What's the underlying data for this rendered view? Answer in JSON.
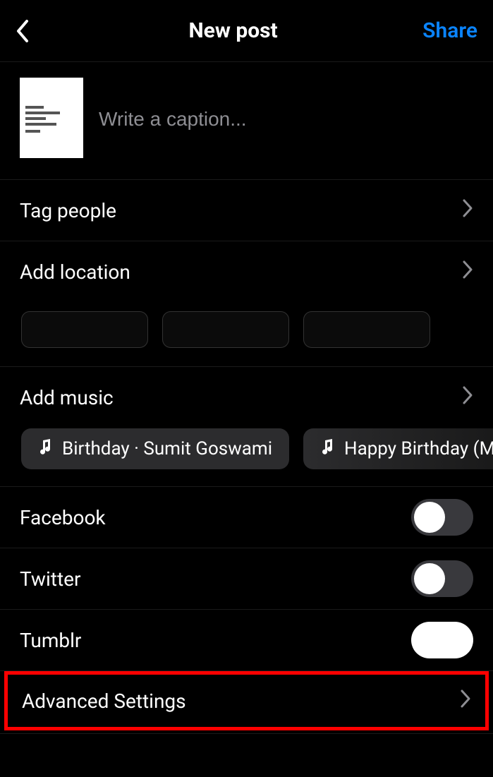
{
  "header": {
    "title": "New post",
    "share": "Share"
  },
  "caption": {
    "placeholder": "Write a caption..."
  },
  "rows": {
    "tag_people": "Tag people",
    "add_location": "Add location",
    "add_music": "Add music",
    "advanced": "Advanced Settings"
  },
  "music": {
    "chip1": "Birthday · Sumit Goswami",
    "chip2": "Happy Birthday (Me"
  },
  "share_to": {
    "facebook": "Facebook",
    "twitter": "Twitter",
    "tumblr": "Tumblr"
  }
}
